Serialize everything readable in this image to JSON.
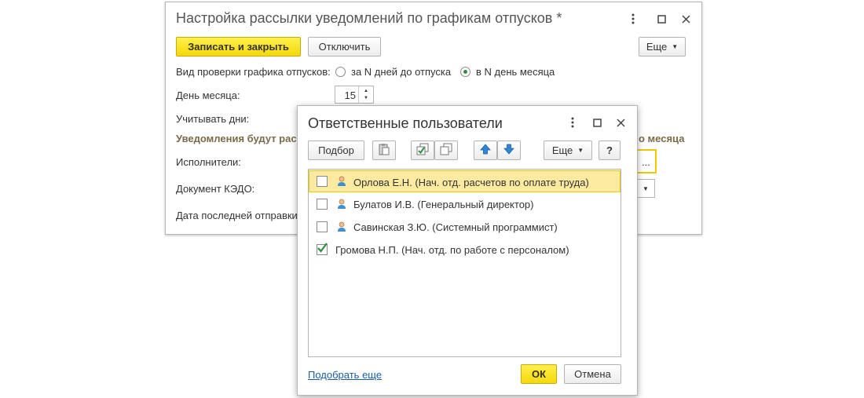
{
  "main_window": {
    "title": "Настройка рассылки уведомлений по графикам отпусков *",
    "save_close_label": "Записать и закрыть",
    "disable_label": "Отключить",
    "more_label": "Еще",
    "check_type_label": "Вид проверки графика отпусков:",
    "radio_option_1": "за N дней до отпуска",
    "radio_option_2": "в N день месяца",
    "selected_option": "в N день месяца",
    "day_of_month_label": "День месяца:",
    "day_of_month_value": "15",
    "consider_days_label": "Учитывать дни:",
    "notifications_label": "Уведомления будут рас",
    "notifications_label_tail": "о месяца",
    "executors_label": "Исполнители:",
    "kedo_doc_label": "Документ КЭДО:",
    "last_sent_label": "Дата последней отправки:",
    "ellipsis_label": "..."
  },
  "dialog": {
    "title": "Ответственные пользователи",
    "pick_label": "Подбор",
    "more_label": "Еще",
    "help_label": "?",
    "pick_more_link": "Подобрать еще",
    "ok_label": "ОК",
    "cancel_label": "Отмена",
    "users": [
      {
        "name": "Орлова Е.Н. (Нач. отд. расчетов по оплате труда)",
        "checked": false,
        "selected": true,
        "icon": "user-icon"
      },
      {
        "name": "Булатов И.В. (Генеральный директор)",
        "checked": false,
        "selected": false,
        "icon": "user-icon"
      },
      {
        "name": "Савинская З.Ю. (Системный программист)",
        "checked": false,
        "selected": false,
        "icon": "user-icon"
      },
      {
        "name": "Громова Н.П. (Нач. отд. по работе с персоналом)",
        "checked": true,
        "selected": false,
        "icon": ""
      }
    ]
  },
  "colors": {
    "accent_yellow": "#f4d90b",
    "selected_row": "#fbeaa0",
    "check_green": "#2a8f3f",
    "arrow_blue": "#2f86d6",
    "link_blue": "#1a5ea8"
  }
}
